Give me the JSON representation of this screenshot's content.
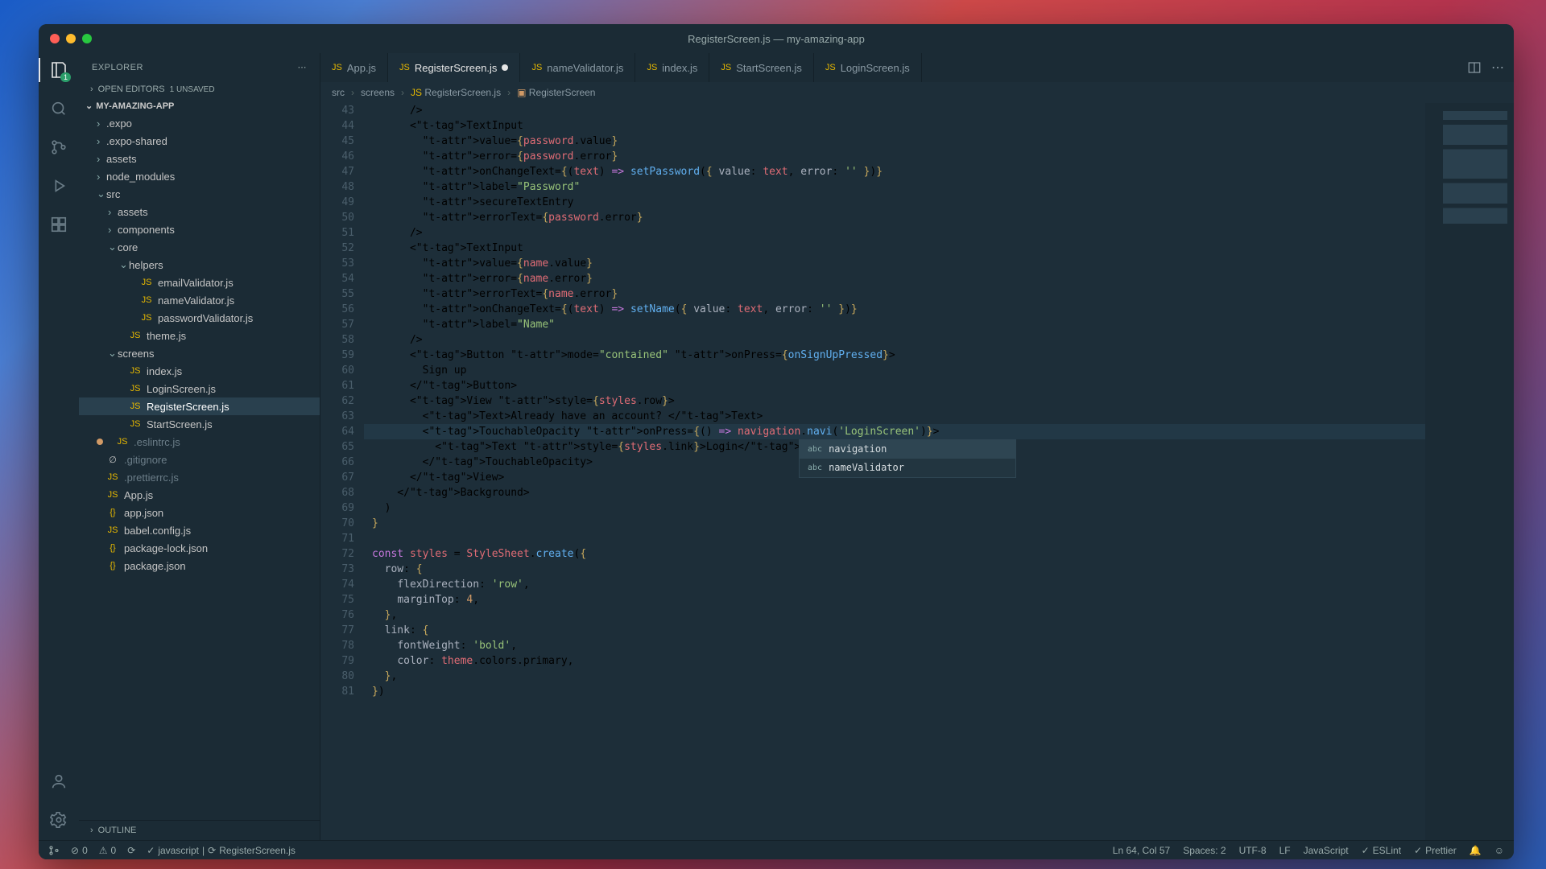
{
  "window": {
    "title": "RegisterScreen.js — my-amazing-app"
  },
  "activity": {
    "badge": "1"
  },
  "sidebar": {
    "title": "EXPLORER",
    "openEditors": "OPEN EDITORS",
    "unsaved": "1 UNSAVED",
    "project": "MY-AMAZING-APP",
    "outline": "OUTLINE",
    "tree": [
      {
        "name": ".expo",
        "depth": 1,
        "type": "folder"
      },
      {
        "name": ".expo-shared",
        "depth": 1,
        "type": "folder"
      },
      {
        "name": "assets",
        "depth": 1,
        "type": "folder"
      },
      {
        "name": "node_modules",
        "depth": 1,
        "type": "folder"
      },
      {
        "name": "src",
        "depth": 1,
        "type": "folder",
        "open": true
      },
      {
        "name": "assets",
        "depth": 2,
        "type": "folder"
      },
      {
        "name": "components",
        "depth": 2,
        "type": "folder"
      },
      {
        "name": "core",
        "depth": 2,
        "type": "folder",
        "open": true
      },
      {
        "name": "helpers",
        "depth": 3,
        "type": "folder",
        "open": true
      },
      {
        "name": "emailValidator.js",
        "depth": 4,
        "type": "js"
      },
      {
        "name": "nameValidator.js",
        "depth": 4,
        "type": "js"
      },
      {
        "name": "passwordValidator.js",
        "depth": 4,
        "type": "js"
      },
      {
        "name": "theme.js",
        "depth": 3,
        "type": "js"
      },
      {
        "name": "screens",
        "depth": 2,
        "type": "folder",
        "open": true
      },
      {
        "name": "index.js",
        "depth": 3,
        "type": "js"
      },
      {
        "name": "LoginScreen.js",
        "depth": 3,
        "type": "js"
      },
      {
        "name": "RegisterScreen.js",
        "depth": 3,
        "type": "js",
        "selected": true
      },
      {
        "name": "StartScreen.js",
        "depth": 3,
        "type": "js"
      },
      {
        "name": ".eslintrc.js",
        "depth": 1,
        "type": "js",
        "dim": true,
        "mod": true
      },
      {
        "name": ".gitignore",
        "depth": 1,
        "type": "file",
        "dim": true
      },
      {
        "name": ".prettierrc.js",
        "depth": 1,
        "type": "js",
        "dim": true
      },
      {
        "name": "App.js",
        "depth": 1,
        "type": "js"
      },
      {
        "name": "app.json",
        "depth": 1,
        "type": "json"
      },
      {
        "name": "babel.config.js",
        "depth": 1,
        "type": "js"
      },
      {
        "name": "package-lock.json",
        "depth": 1,
        "type": "json"
      },
      {
        "name": "package.json",
        "depth": 1,
        "type": "json"
      }
    ]
  },
  "tabs": [
    {
      "label": "App.js",
      "icon": "js"
    },
    {
      "label": "RegisterScreen.js",
      "icon": "js",
      "active": true,
      "modified": true
    },
    {
      "label": "nameValidator.js",
      "icon": "js"
    },
    {
      "label": "index.js",
      "icon": "js"
    },
    {
      "label": "StartScreen.js",
      "icon": "js"
    },
    {
      "label": "LoginScreen.js",
      "icon": "js"
    }
  ],
  "breadcrumbs": [
    "src",
    "screens",
    "RegisterScreen.js",
    "RegisterScreen"
  ],
  "editor": {
    "startLine": 43,
    "highlightLine": 64,
    "lines": [
      "      />",
      "      <TextInput",
      "        value={password.value}",
      "        error={password.error}",
      "        onChangeText={(text) => setPassword({ value: text, error: '' })}",
      "        label=\"Password\"",
      "        secureTextEntry",
      "        errorText={password.error}",
      "      />",
      "      <TextInput",
      "        value={name.value}",
      "        error={name.error}",
      "        errorText={name.error}",
      "        onChangeText={(text) => setName({ value: text, error: '' })}",
      "        label=\"Name\"",
      "      />",
      "      <Button mode=\"contained\" onPress={onSignUpPressed}>",
      "        Sign up",
      "      </Button>",
      "      <View style={styles.row}>",
      "        <Text>Already have an account? </Text>",
      "        <TouchableOpacity onPress={() => navigation.navi('LoginScreen')}>",
      "          <Text style={styles.link}>Login</Text>",
      "        </TouchableOpacity>",
      "      </View>",
      "    </Background>",
      "  )",
      "}",
      "",
      "const styles = StyleSheet.create({",
      "  row: {",
      "    flexDirection: 'row',",
      "    marginTop: 4,",
      "  },",
      "  link: {",
      "    fontWeight: 'bold',",
      "    color: theme.colors.primary,",
      "  },",
      "})"
    ]
  },
  "suggest": {
    "items": [
      {
        "kind": "abc",
        "label": "navigation"
      },
      {
        "kind": "abc",
        "label": "nameValidator"
      }
    ]
  },
  "status": {
    "errors": "0",
    "warnings": "0",
    "lang": "javascript",
    "file": "RegisterScreen.js",
    "lncol": "Ln 64, Col 57",
    "spaces": "Spaces: 2",
    "enc": "UTF-8",
    "eol": "LF",
    "mode": "JavaScript",
    "eslint": "ESLint",
    "prettier": "Prettier"
  }
}
